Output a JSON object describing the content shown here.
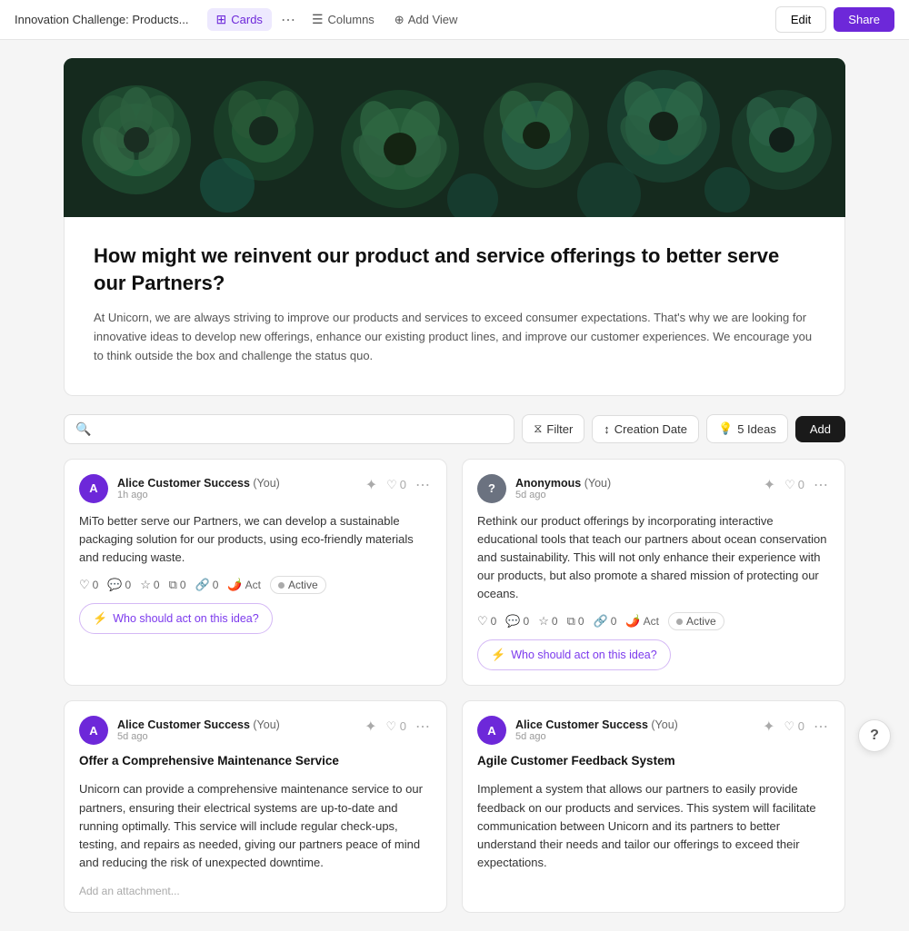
{
  "nav": {
    "title": "Innovation Challenge: Products...",
    "views": [
      {
        "label": "Cards",
        "icon": "⊞",
        "active": true
      },
      {
        "label": "Columns",
        "icon": "⊟",
        "active": false
      }
    ],
    "add_view_label": "Add View",
    "edit_label": "Edit",
    "share_label": "Share"
  },
  "challenge": {
    "title": "How might we reinvent our product and service offerings to better serve our Partners?",
    "description": "At Unicorn, we are always striving to improve our products and services to exceed consumer expectations. That's why we are looking for innovative ideas to develop new offerings, enhance our existing product lines, and improve our customer experiences. We encourage you to think outside the box and challenge the status quo."
  },
  "toolbar": {
    "search_placeholder": "",
    "filter_label": "Filter",
    "sort_label": "Creation Date",
    "ideas_count": "5 Ideas",
    "add_label": "Add"
  },
  "cards": [
    {
      "id": 1,
      "user": "Alice Customer Success",
      "you_label": "(You)",
      "time": "1h ago",
      "avatar_letter": "A",
      "avatar_color": "#6d28d9",
      "body": "MiTo better serve our Partners, we can develop a sustainable packaging solution for our products, using eco-friendly materials and reducing waste.",
      "stats": {
        "likes": 0,
        "comments": 0,
        "stars": 0,
        "copy": 0,
        "link": 0
      },
      "act_label": "Act",
      "status_label": "Active",
      "who_act_label": "Who should act on this idea?"
    },
    {
      "id": 2,
      "user": "Anonymous",
      "you_label": "(You)",
      "time": "5d ago",
      "avatar_letter": "?",
      "avatar_color": "#6b7280",
      "body": "Rethink our product offerings by incorporating interactive educational tools that teach our partners about ocean conservation and sustainability. This will not only enhance their experience with our products, but also promote a shared mission of protecting our oceans.",
      "stats": {
        "likes": 0,
        "comments": 0,
        "stars": 0,
        "copy": 0,
        "link": 0
      },
      "act_label": "Act",
      "status_label": "Active",
      "who_act_label": "Who should act on this idea?"
    },
    {
      "id": 3,
      "user": "Alice Customer Success",
      "you_label": "(You)",
      "time": "5d ago",
      "avatar_letter": "A",
      "avatar_color": "#6d28d9",
      "title": "Offer a Comprehensive Maintenance Service",
      "body": "Unicorn can provide a comprehensive maintenance service to our partners, ensuring their electrical systems are up-to-date and running optimally. This service will include regular check-ups, testing, and repairs as needed, giving our partners peace of mind and reducing the risk of unexpected downtime.",
      "stats": null,
      "attachment_label": "Add an attachment..."
    },
    {
      "id": 4,
      "user": "Alice Customer Success",
      "you_label": "(You)",
      "time": "5d ago",
      "avatar_letter": "A",
      "avatar_color": "#6d28d9",
      "title": "Agile Customer Feedback System",
      "body": "Implement a system that allows our partners to easily provide feedback on our products and services. This system will facilitate communication between Unicorn and its partners to better understand their needs and tailor our offerings to exceed their expectations.",
      "stats": null
    }
  ],
  "help": {
    "label": "?"
  }
}
